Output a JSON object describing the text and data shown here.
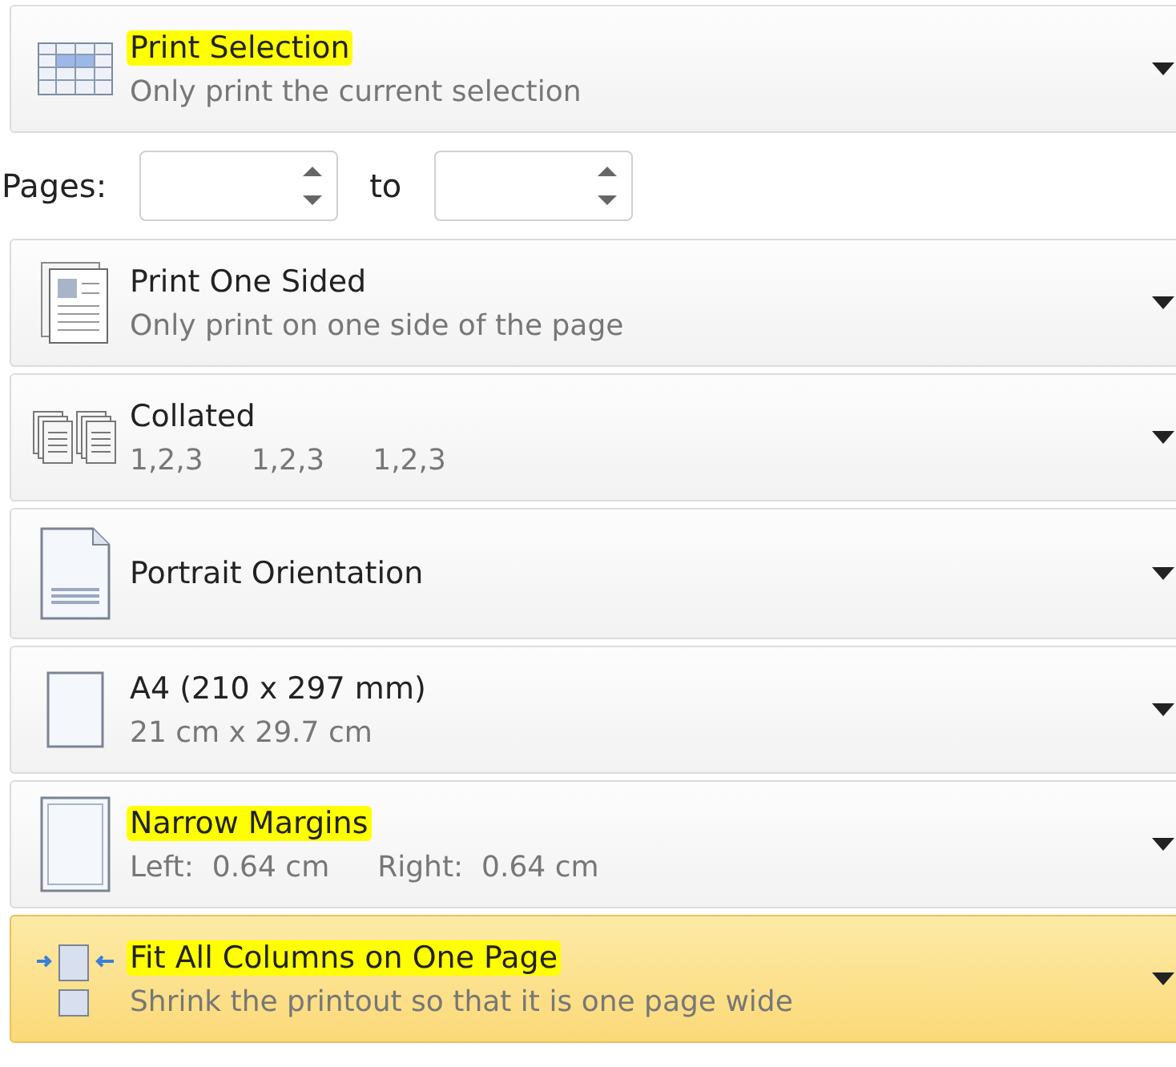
{
  "settings": [
    {
      "kind": "selection",
      "title": "Print Selection",
      "subtitle": [
        "Only print the current selection"
      ],
      "highlighted": true,
      "selected": false
    },
    {
      "kind": "page_range",
      "label": "Pages:",
      "between": "to"
    },
    {
      "kind": "sides",
      "title": "Print One Sided",
      "subtitle": [
        "Only print on one side of the page"
      ],
      "highlighted": false,
      "selected": false
    },
    {
      "kind": "collation",
      "title": "Collated",
      "subtitle": [
        "1,2,3",
        "1,2,3",
        "1,2,3"
      ],
      "highlighted": false,
      "selected": false
    },
    {
      "kind": "orientation",
      "title": "Portrait Orientation",
      "highlighted": false,
      "selected": false
    },
    {
      "kind": "paper_size",
      "title": "A4 (210 x 297 mm)",
      "subtitle": [
        "21 cm x 29.7 cm"
      ],
      "highlighted": false,
      "selected": false
    },
    {
      "kind": "margins",
      "title": "Narrow Margins",
      "subtitle": [
        "Left:  0.64 cm",
        "Right:  0.64 cm"
      ],
      "highlighted": true,
      "selected": false
    },
    {
      "kind": "scaling",
      "title": "Fit All Columns on One Page",
      "subtitle": [
        "Shrink the printout so that it is one page wide"
      ],
      "highlighted": true,
      "selected": true
    }
  ]
}
